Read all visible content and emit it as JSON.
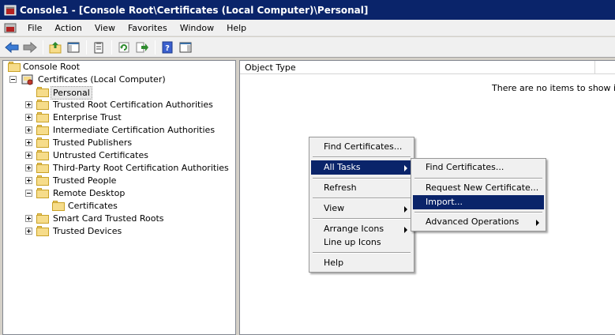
{
  "window": {
    "title": "Console1 - [Console Root\\Certificates (Local Computer)\\Personal]"
  },
  "menubar": {
    "items": [
      "File",
      "Action",
      "View",
      "Favorites",
      "Window",
      "Help"
    ]
  },
  "toolbar": {
    "icons": [
      "back-icon",
      "forward-icon",
      "up-folder-icon",
      "show-hide-tree-icon",
      "properties-icon",
      "refresh-icon",
      "export-list-icon",
      "help-icon",
      "show-hide-action-pane-icon"
    ]
  },
  "tree": {
    "root": "Console Root",
    "certificates": "Certificates (Local Computer)",
    "items": [
      {
        "label": "Personal"
      },
      {
        "label": "Trusted Root Certification Authorities"
      },
      {
        "label": "Enterprise Trust"
      },
      {
        "label": "Intermediate Certification Authorities"
      },
      {
        "label": "Trusted Publishers"
      },
      {
        "label": "Untrusted Certificates"
      },
      {
        "label": "Third-Party Root Certification Authorities"
      },
      {
        "label": "Trusted People"
      },
      {
        "label": "Remote Desktop"
      },
      {
        "label": "Certificates"
      },
      {
        "label": "Smart Card Trusted Roots"
      },
      {
        "label": "Trusted Devices"
      }
    ]
  },
  "listview": {
    "column": "Object Type",
    "empty_message": "There are no items to show in thi"
  },
  "context_menu": {
    "items": [
      "Find Certificates...",
      "All Tasks",
      "Refresh",
      "View",
      "Arrange Icons",
      "Line up Icons",
      "Help"
    ]
  },
  "submenu": {
    "items": [
      "Find Certificates...",
      "Request New Certificate...",
      "Import...",
      "Advanced Operations"
    ]
  },
  "colors": {
    "titlebar": "#0a246a",
    "highlight": "#0a246a",
    "menu_bg": "#f0f0f0"
  }
}
